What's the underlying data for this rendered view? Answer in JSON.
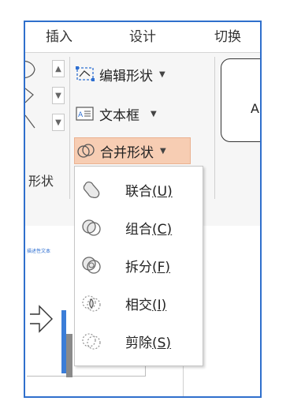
{
  "tabs": [
    "插入",
    "设计",
    "切换"
  ],
  "ribbon": {
    "group_label": "形状",
    "edit_shape_label": "编辑形状",
    "textbox_label": "文本框",
    "merge_shapes_label": "合并形状",
    "dropdown_arrow": "▼",
    "style_preview_letter": "A"
  },
  "slide": {
    "thumbnail_text": "描述性文本"
  },
  "merge_menu": {
    "items": [
      {
        "label": "联合",
        "key": "(U)",
        "icon": "union-icon"
      },
      {
        "label": "组合",
        "key": "(C)",
        "icon": "combine-icon"
      },
      {
        "label": "拆分",
        "key": "(F)",
        "icon": "fragment-icon"
      },
      {
        "label": "相交",
        "key": "(I)",
        "icon": "intersect-icon"
      },
      {
        "label": "剪除",
        "key": "(S)",
        "icon": "subtract-icon"
      }
    ]
  },
  "colors": {
    "frame": "#2f6fcc",
    "merge_highlight": "#f7cdb3"
  }
}
